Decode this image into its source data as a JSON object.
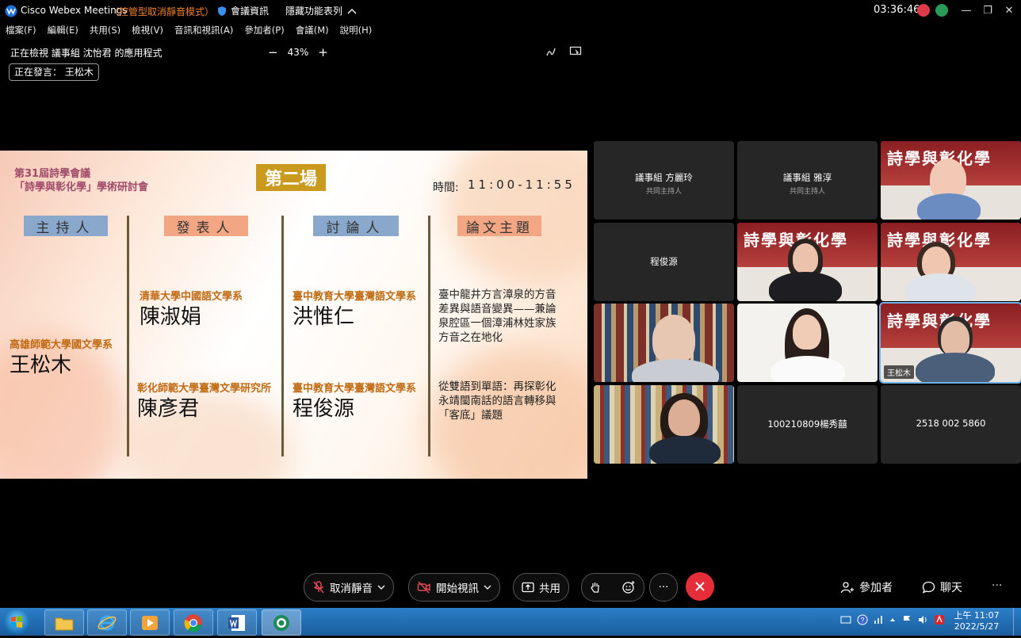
{
  "window": {
    "app_name": "Cisco Webex Meetings",
    "mode": "（控管型取消靜音模式）",
    "meeting_info": "會議資訊",
    "hidden_menu": "隱藏功能表列",
    "clock": "03:36:46",
    "minimize": "—",
    "restore": "❐",
    "close": "✕"
  },
  "menu": [
    "檔案(F)",
    "編輯(E)",
    "共用(S)",
    "檢視(V)",
    "音訊和視訊(A)",
    "參加者(P)",
    "會議(M)",
    "說明(H)"
  ],
  "share": {
    "viewing_text": "正在檢視 議事組 沈怡君 的應用程式",
    "zoom_minus": "−",
    "zoom_level": "43%",
    "zoom_plus": "+",
    "speaking_text": "正在發言： 王松木"
  },
  "slide": {
    "conf_line1": "第31屆詩學會議",
    "conf_line2": "「詩學與彰化學」學術研討會",
    "session": "第二場",
    "time_label": "時間:",
    "time_value": "11:00-11:55",
    "headers": [
      "主持人",
      "發表人",
      "討論人",
      "論文主題"
    ],
    "host_affiliation": "高雄師範大學國文學系",
    "host_name": "王松木",
    "rows": [
      {
        "presenter_affiliation": "清華大學中國語文學系",
        "presenter_name": "陳淑娟",
        "discussant_affiliation": "臺中教育大學臺灣語文學系",
        "discussant_name": "洪惟仁",
        "topic": "臺中龍井方言漳泉的方音差異與語音變異——兼論泉腔區一個漳浦林姓家族方音之在地化"
      },
      {
        "presenter_affiliation": "彰化師範大學臺灣文學研究所",
        "presenter_name": "陳彥君",
        "discussant_affiliation": "臺中教育大學臺灣語文學系",
        "discussant_name": "程俊源",
        "topic": "從雙語到單語：再探彰化永靖閩南話的語言轉移與「客底」議題"
      }
    ]
  },
  "participants": {
    "tile1_name": "議事組 方麗玲",
    "tile1_role": "共同主持人",
    "tile2_name": "議事組 雅淳",
    "tile2_role": "共同主持人",
    "tile4_name": "程俊源",
    "banner_text": "詩學與彰化學",
    "active_label": "王松木",
    "tile11_name": "100210809楊秀囍",
    "tile12_name": "2518 002 5860"
  },
  "controls": {
    "unmute": "取消靜音",
    "start_video": "開始視訊",
    "share": "共用",
    "more": "···",
    "participants": "參加者",
    "chat": "聊天",
    "overflow": "···"
  },
  "taskbar": {
    "time": "上午 11:07",
    "date": "2022/5/27"
  }
}
